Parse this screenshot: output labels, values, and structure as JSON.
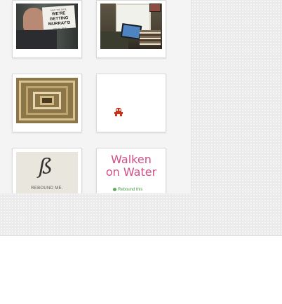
{
  "gallery": {
    "cards": [
      {
        "kind": "photo",
        "sign": {
          "top": "SAVE THE DATE",
          "main": "WE'RE GETTING MURRAY'D",
          "date": "NOV 18, 2012"
        }
      },
      {
        "kind": "photo"
      },
      {
        "kind": "photo"
      },
      {
        "kind": "sprite"
      },
      {
        "kind": "logo",
        "caption": "REBOUND ME."
      },
      {
        "kind": "title",
        "line1": "Walken",
        "line2": "on Water",
        "rebound": "Rebound this"
      }
    ]
  },
  "colors": {
    "background": "#ececec",
    "card_border": "#dadada",
    "pink_title": "#d24e86",
    "rebound_green": "#5cb356",
    "sprite_red": "#c5331d"
  }
}
